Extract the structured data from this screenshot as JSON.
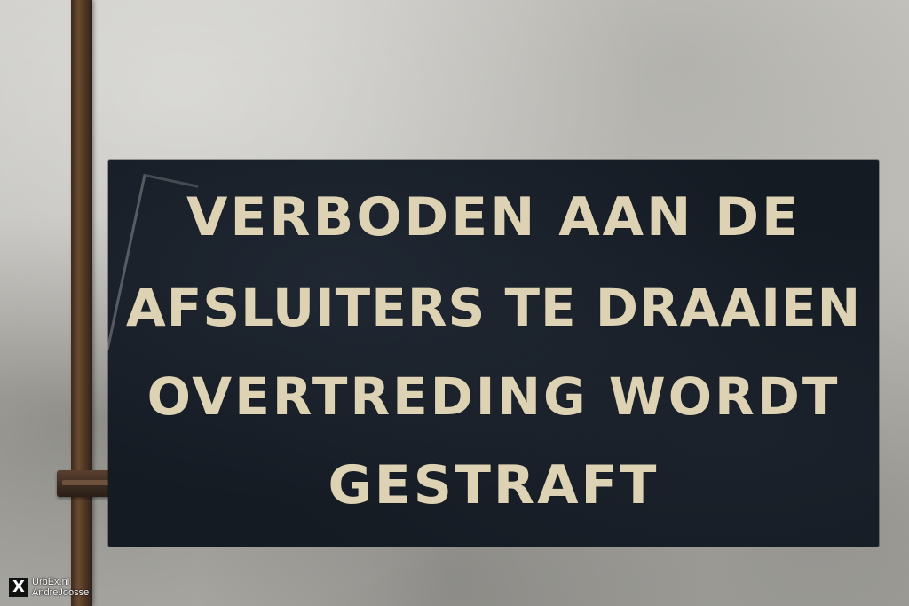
{
  "sign": {
    "line_1": "VERBODEN AAN DE",
    "line_2": "AFSLUITERS TE DRAAIEN",
    "line_3": "OVERTREDING WORDT",
    "line_4": "GESTRAFT"
  },
  "watermark": {
    "logo_glyph": "X",
    "site": "UrbEx.nl",
    "author": "AndreJoosse"
  },
  "colors": {
    "sign_background": "#151b23",
    "sign_lettering": "#ddd3b4",
    "wall": "#bdbcb7",
    "pipe_rust": "#6b4a30"
  }
}
